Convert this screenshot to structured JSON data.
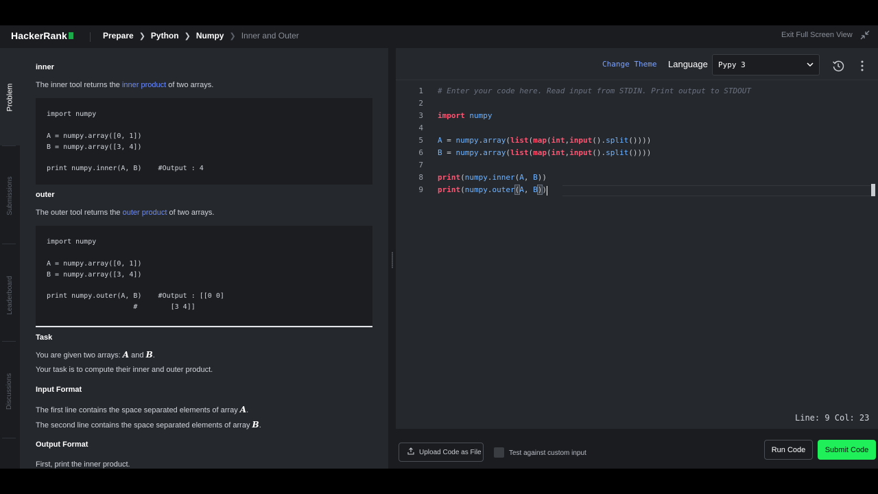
{
  "header": {
    "logo": "HackerRank",
    "breadcrumbs": [
      "Prepare",
      "Python",
      "Numpy"
    ],
    "current": "Inner and Outer",
    "exit_fullscreen": "Exit Full Screen View"
  },
  "sidenav": {
    "tabs": [
      "Problem",
      "Submissions",
      "Leaderboard",
      "Discussions"
    ],
    "active": "Problem"
  },
  "problem": {
    "inner_title": "inner",
    "inner_desc_pre": "The inner tool returns the ",
    "inner_link": "inner product",
    "inner_desc_post": " of two arrays.",
    "inner_code": [
      "import numpy",
      "A = numpy.array([0, 1])",
      "B = numpy.array([3, 4])",
      "print numpy.inner(A, B)    #Output : 4"
    ],
    "outer_title": "outer",
    "outer_desc_pre": "The outer tool returns the ",
    "outer_link": "outer product",
    "outer_desc_post": " of two arrays.",
    "outer_code": [
      "import numpy",
      "A = numpy.array([0, 1])",
      "B = numpy.array([3, 4])",
      "print numpy.outer(A, B)    #Output : [[0 0]",
      "                     #        [3 4]]"
    ],
    "task_title": "Task",
    "task_line1_pre": "You are given two arrays: ",
    "task_var_a": "A",
    "task_and": " and ",
    "task_var_b": "B",
    "task_period": ".",
    "task_line2": "Your task is to compute their inner and outer product.",
    "input_title": "Input Format",
    "input_line1_pre": "The first line contains the space separated elements of array ",
    "input_line1_var": "A",
    "input_line2_pre": "The second line contains the space separated elements of array ",
    "input_line2_var": "B",
    "output_title": "Output Format",
    "output_line1": "First, print the inner product."
  },
  "editor": {
    "change_theme": "Change Theme",
    "language_label": "Language",
    "language_value": "Pypy 3",
    "line_numbers": [
      "1",
      "2",
      "3",
      "4",
      "5",
      "6",
      "7",
      "8",
      "9"
    ],
    "status": "Line: 9 Col: 23"
  },
  "actions": {
    "upload": "Upload Code as File",
    "custom_input": "Test against custom input",
    "run": "Run Code",
    "submit": "Submit Code"
  },
  "colors": {
    "accent_green": "#1ff05a",
    "link_blue": "#6b8cff",
    "keyword_red": "#ff5370",
    "identifier_blue": "#6fb3ff"
  }
}
